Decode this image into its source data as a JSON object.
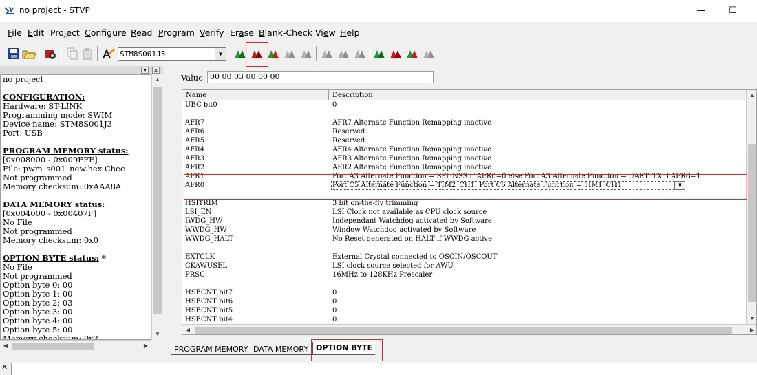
{
  "window": {
    "title": "no project - STVP"
  },
  "menu": [
    {
      "label": "File",
      "u": "F",
      "rest": "ile"
    },
    {
      "label": "Edit",
      "u": "E",
      "rest": "dit"
    },
    {
      "label": "Project",
      "u": "",
      "rest": ""
    },
    {
      "label": "Configure",
      "u": "C",
      "rest": "onfigure"
    },
    {
      "label": "Read",
      "u": "R",
      "rest": "ead"
    },
    {
      "label": "Program",
      "u": "P",
      "rest": "rogram"
    },
    {
      "label": "Verify",
      "u": "V",
      "rest": "erify"
    },
    {
      "label": "Erase",
      "u": "",
      "rest": ""
    },
    {
      "label": "Blank-Check",
      "u": "B",
      "rest": "lank-Check"
    },
    {
      "label": "View",
      "u": "",
      "rest": ""
    },
    {
      "label": "Help",
      "u": "H",
      "rest": "elp"
    }
  ],
  "menu_project": {
    "pre": "Pro",
    "u": "j",
    "post": "ect"
  },
  "menu_erase": {
    "pre": "Er",
    "u": "a",
    "post": "se"
  },
  "menu_view": {
    "pre": "Vi",
    "u": "e",
    "post": "w"
  },
  "toolbar": {
    "device": "STM8S001J3"
  },
  "left_panel": {
    "project": "no project",
    "configuration_heading": "CONFIGURATION:",
    "config_lines": [
      "Hardware: ST-LINK",
      "Programming mode: SWIM",
      "Device name: STM8S001J3",
      "Port: USB"
    ],
    "program_heading": "PROGRAM MEMORY status:",
    "program_lines": [
      "[0x008000 - 0x009FFF]",
      "File: pwm_s001_new.hex Chec",
      "Not programmed",
      "Memory checksum: 0xAAA8A"
    ],
    "data_heading": "DATA MEMORY status:",
    "data_lines": [
      "[0x004000 - 0x00407F]",
      "No File",
      "Not programmed",
      "Memory checksum: 0x0"
    ],
    "option_heading": "OPTION BYTE status:",
    "option_star": " *",
    "option_lines": [
      "No File",
      "Not programmed",
      "Option byte 0: 00",
      "Option byte 1: 00",
      "Option byte 2: 03",
      "Option byte 3: 00",
      "Option byte 4: 00",
      "Option byte 5: 00",
      "Memory checksum: 0x3"
    ]
  },
  "option_view": {
    "value_label": "Value",
    "value": "00 00 03 00 00 00",
    "columns": [
      "Name",
      "Description"
    ],
    "rows": [
      {
        "name": "UBC bit0",
        "desc": "0"
      },
      {
        "name": "",
        "desc": ""
      },
      {
        "name": "AFR7",
        "desc": "AFR7 Alternate Function Remapping inactive"
      },
      {
        "name": "AFR6",
        "desc": "Reserved"
      },
      {
        "name": "AFR5",
        "desc": "Reserved"
      },
      {
        "name": "AFR4",
        "desc": "AFR4 Alternate Function Remapping inactive"
      },
      {
        "name": "AFR3",
        "desc": "AFR3 Alternate Function Remapping inactive"
      },
      {
        "name": "AFR2",
        "desc": "AFR2 Alternate Function Remapping inactive"
      },
      {
        "name": "AFR1",
        "desc": "Port A3 Alternate Function = SPI_NSS if AFR0=0 else Port A3 Alternate Function = UART_TX if AFR0=1"
      },
      {
        "name": "AFR0",
        "desc": "Port C5 Alternate Function = TIM2_CH1, Port C6 Alternate Function = TIM1_CH1"
      },
      {
        "name": "",
        "desc": ""
      },
      {
        "name": "HSITRIM",
        "desc": "3 bit on-the-fly trimming"
      },
      {
        "name": "LSI_EN",
        "desc": "LSI Clock not available as CPU clock source"
      },
      {
        "name": "IWDG_HW",
        "desc": "Independant Watchdog activated by Software"
      },
      {
        "name": "WWDG_HW",
        "desc": "Window Watchdog activated by Software"
      },
      {
        "name": "WWDG_HALT",
        "desc": "No Reset generated on HALT if WWDG active"
      },
      {
        "name": "",
        "desc": ""
      },
      {
        "name": "EXTCLK",
        "desc": "External Crystal connected to OSCIN/OSCOUT"
      },
      {
        "name": "CKAWUSEL",
        "desc": "LSI clock source selected for AWU"
      },
      {
        "name": "PRSC",
        "desc": "16MHz to 128KHz Prescaler"
      },
      {
        "name": "",
        "desc": ""
      },
      {
        "name": "HSECNT bit7",
        "desc": "0"
      },
      {
        "name": "HSECNT bit6",
        "desc": "0"
      },
      {
        "name": "HSECNT bit5",
        "desc": "0"
      },
      {
        "name": "HSECNT bit4",
        "desc": "0"
      }
    ]
  },
  "tabs": [
    "PROGRAM MEMORY",
    "DATA MEMORY",
    "OPTION BYTE"
  ],
  "active_tab": "OPTION BYTE",
  "colors": {
    "highlight": "#e0282c",
    "icon_green": "#1e9a2e",
    "icon_red": "#d01818",
    "icon_gray": "#9a9a9a"
  }
}
